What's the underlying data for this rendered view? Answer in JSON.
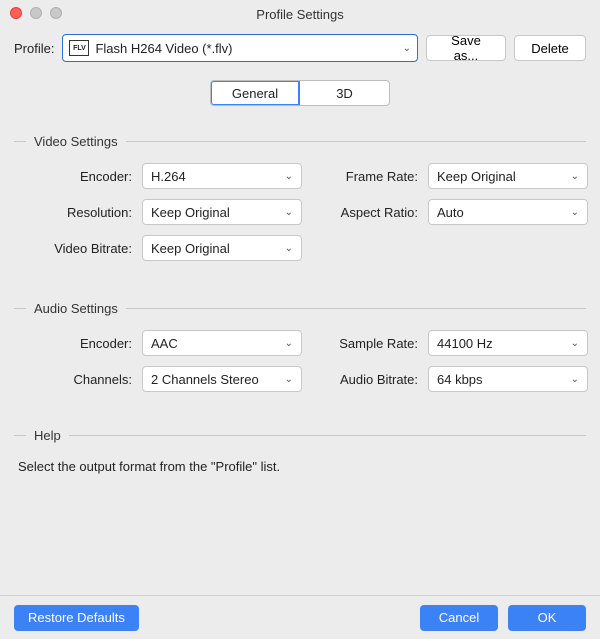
{
  "window": {
    "title": "Profile Settings"
  },
  "profile": {
    "label": "Profile:",
    "selected": "Flash H264 Video (*.flv)",
    "icon_text": "FLV",
    "save_as_label": "Save as...",
    "delete_label": "Delete"
  },
  "tabs": {
    "general": "General",
    "three_d": "3D",
    "active": "general"
  },
  "video": {
    "title": "Video Settings",
    "encoder_label": "Encoder:",
    "encoder_value": "H.264",
    "resolution_label": "Resolution:",
    "resolution_value": "Keep Original",
    "bitrate_label": "Video Bitrate:",
    "bitrate_value": "Keep Original",
    "framerate_label": "Frame Rate:",
    "framerate_value": "Keep Original",
    "aspect_label": "Aspect Ratio:",
    "aspect_value": "Auto"
  },
  "audio": {
    "title": "Audio Settings",
    "encoder_label": "Encoder:",
    "encoder_value": "AAC",
    "channels_label": "Channels:",
    "channels_value": "2 Channels Stereo",
    "samplerate_label": "Sample Rate:",
    "samplerate_value": "44100 Hz",
    "bitrate_label": "Audio Bitrate:",
    "bitrate_value": "64 kbps"
  },
  "help": {
    "title": "Help",
    "text": "Select the output format from the \"Profile\" list."
  },
  "footer": {
    "restore_label": "Restore Defaults",
    "cancel_label": "Cancel",
    "ok_label": "OK"
  }
}
